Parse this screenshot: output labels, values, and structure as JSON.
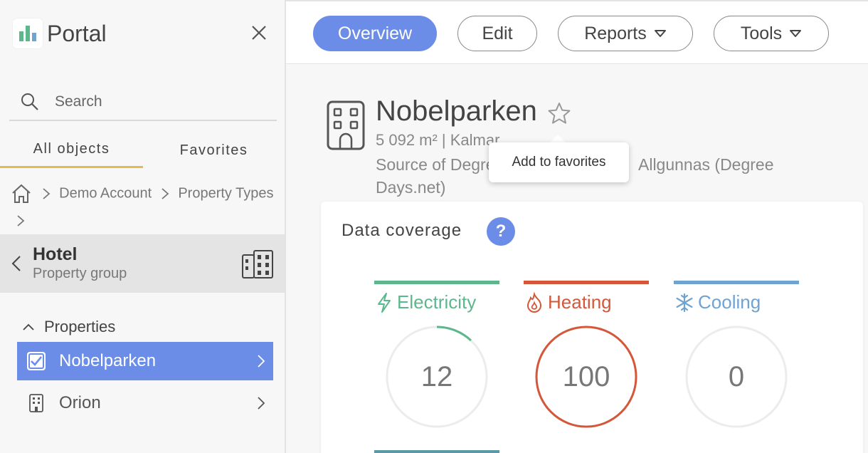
{
  "app": {
    "name": "Portal"
  },
  "colors": {
    "accent": "#6b8de8",
    "tab_underline": "#e5b94d",
    "electricity": "#5cb88c",
    "heating": "#d4573a",
    "cooling": "#6fa3d1"
  },
  "sidebar": {
    "search_placeholder": "Search",
    "tabs": [
      {
        "label": "All objects",
        "active": true
      },
      {
        "label": "Favorites",
        "active": false
      }
    ],
    "breadcrumb": [
      "Demo Account",
      "Property Types"
    ],
    "group": {
      "title": "Hotel",
      "subtitle": "Property group"
    },
    "properties_label": "Properties",
    "properties": [
      {
        "name": "Nobelparken",
        "selected": true
      },
      {
        "name": "Orion",
        "selected": false
      }
    ]
  },
  "toolbar": {
    "buttons": [
      {
        "label": "Overview",
        "dropdown": false,
        "active": true
      },
      {
        "label": "Edit",
        "dropdown": false,
        "active": false
      },
      {
        "label": "Reports",
        "dropdown": true,
        "active": false
      },
      {
        "label": "Tools",
        "dropdown": true,
        "active": false
      }
    ]
  },
  "building": {
    "name": "Nobelparken",
    "meta": "5 092 m² | Kalmar",
    "source_start": "Source of Degre",
    "source_end": "Allgunnas (Degree Days.net)",
    "tooltip": "Add to favorites"
  },
  "coverage": {
    "title": "Data coverage",
    "help": "?",
    "meters": [
      {
        "name": "Electricity",
        "value": "12",
        "percent": 12
      },
      {
        "name": "Heating",
        "value": "100",
        "percent": 100
      },
      {
        "name": "Cooling",
        "value": "0",
        "percent": 0
      }
    ]
  }
}
